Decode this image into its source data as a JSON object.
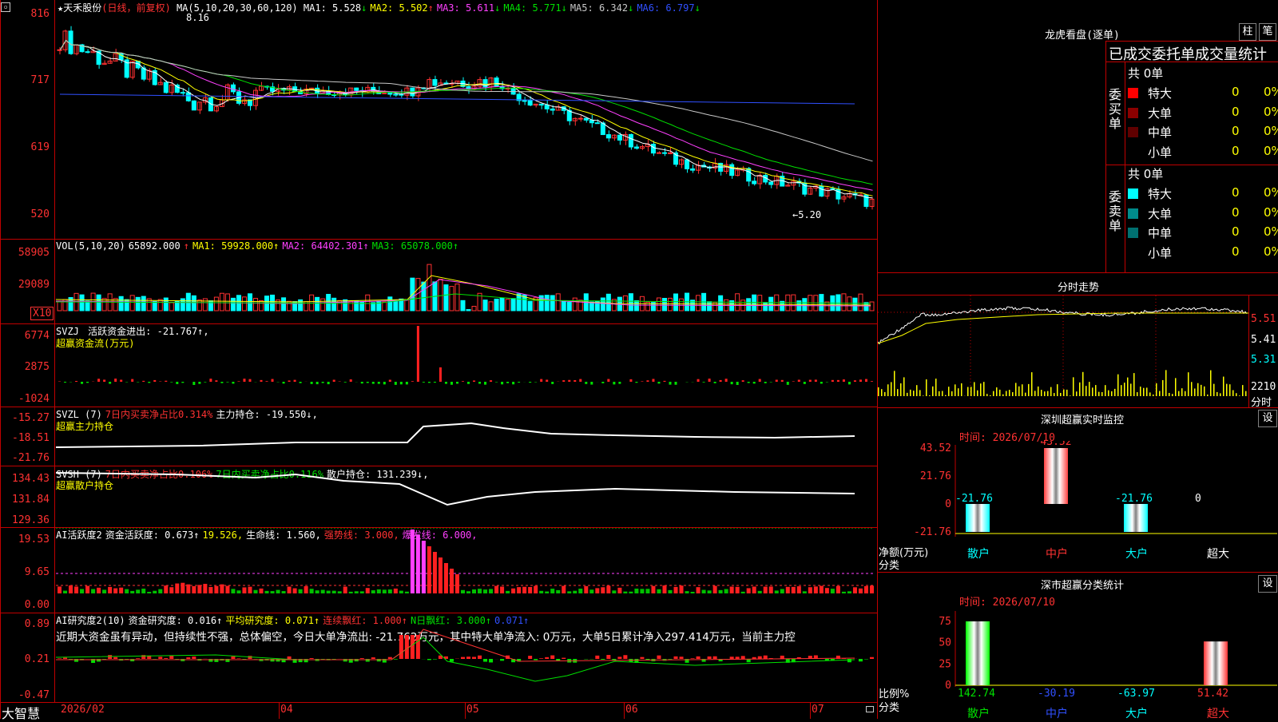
{
  "header": {
    "star": "★",
    "stock_name": "天禾股份",
    "period_info": "(日线，前复权)",
    "ma_label": "MA(5,10,20,30,60,120)",
    "ma": [
      {
        "label": "MA1:",
        "value": "5.528",
        "dir": "↓",
        "color": "#ffffff"
      },
      {
        "label": "MA2:",
        "value": "5.502",
        "dir": "↑",
        "color": "#ffff00"
      },
      {
        "label": "MA3:",
        "value": "5.611",
        "dir": "↓",
        "color": "#ff40ff"
      },
      {
        "label": "MA4:",
        "value": "5.771",
        "dir": "↓",
        "color": "#00e000"
      },
      {
        "label": "MA5:",
        "value": "6.342",
        "dir": "↓",
        "color": "#c8c8c8"
      },
      {
        "label": "MA6:",
        "value": "6.797",
        "dir": "↓",
        "color": "#3050ff"
      }
    ],
    "corner_icon": "restore-icon"
  },
  "main_chart": {
    "y_labels": [
      "816",
      "717",
      "619",
      "520"
    ],
    "high_label": "8.16",
    "low_label": "←5.20"
  },
  "volume_panel": {
    "title": "VOL(5,10,20)",
    "vol": "65892.000",
    "vol_dir": "↑",
    "ma1": "MA1: 59928.000↑",
    "ma2": "MA2: 64402.301↑",
    "ma3": "MA3: 65078.000↑",
    "y_labels": [
      "58905",
      "29089"
    ],
    "unit": "X10"
  },
  "svzj_panel": {
    "title": "SVZJ",
    "text": "活跃资金进出: -21.767↑,",
    "subtitle": "超赢资金流(万元)",
    "y_labels": [
      "6774",
      "2875",
      "-1024"
    ]
  },
  "svzl_panel": {
    "title": "SVZL (7)",
    "ratio": "7日内买卖净占比0.314%",
    "holding": "主力持仓: -19.550↓,",
    "subtitle": "超赢主力持仓",
    "y_labels": [
      "-15.27",
      "-18.51",
      "-21.76"
    ]
  },
  "svsh_panel": {
    "title": "SVSH (7)",
    "ratio1": "7日内买卖净占比0.106%",
    "ratio2": "7日内买卖净占比0.116%",
    "holding": "散户持仓: 131.239↓,",
    "subtitle": "超赢散户持仓",
    "y_labels": [
      "134.43",
      "131.84",
      "129.36"
    ]
  },
  "ai_active_panel": {
    "title": "AI活跃度2",
    "a": "资金活跃度: 0.673↑",
    "b": "19.526,",
    "c": "生命线: 1.560,",
    "d": "强势线: 3.000,",
    "e": "爆发线: 6.000,",
    "y_labels": [
      "19.53",
      "9.65",
      "0.00"
    ]
  },
  "ai_research_panel": {
    "title": "AI研究度2(10)",
    "a": "资金研究度: 0.016↑",
    "b": "平均研究度: 0.071↑",
    "c": "连续飘红: 1.000↑",
    "d": "N日飘红: 3.000↑",
    "e": "0.071↑",
    "comment": "近期大资金虽有异动，但持续性不强，总体偏空，今日大单净流出: -21.762万元，其中特大单净流入: 0万元，大单5日累计净入297.414万元，当前主力控",
    "y_labels": [
      "0.89",
      "0.21",
      "-0.47"
    ]
  },
  "x_axis": {
    "brand": "大智慧",
    "dates": [
      "2026/02",
      "04",
      "05",
      "06",
      "07"
    ]
  },
  "dragon_tiger": {
    "title": "龙虎看盘(逐单)",
    "btn1": "柱",
    "btn2": "笔",
    "subtitle": "已成交委托单成交量统计",
    "buy_label": "委买单",
    "sell_label": "委卖单",
    "buy_total": "共 0单",
    "sell_total": "共 0单",
    "buy_rows": [
      {
        "label": "特大",
        "count": "0",
        "pct": "0%",
        "color": "#ff0000"
      },
      {
        "label": "大单",
        "count": "0",
        "pct": "0%",
        "color": "#8b0000"
      },
      {
        "label": "中单",
        "count": "0",
        "pct": "0%",
        "color": "#600000"
      },
      {
        "label": "小单",
        "count": "0",
        "pct": "0%",
        "color": ""
      }
    ],
    "sell_rows": [
      {
        "label": "特大",
        "count": "0",
        "pct": "0%",
        "color": "#00ffff"
      },
      {
        "label": "大单",
        "count": "0",
        "pct": "0%",
        "color": "#008b8b"
      },
      {
        "label": "中单",
        "count": "0",
        "pct": "0%",
        "color": "#007070"
      },
      {
        "label": "小单",
        "count": "0",
        "pct": "0%",
        "color": ""
      }
    ]
  },
  "intraday": {
    "title": "分时走势",
    "y_labels": [
      "5.51",
      "5.41",
      "5.31"
    ],
    "vol_label": "2210",
    "vol_unit": "分时"
  },
  "sz_monitor": {
    "title": "深圳超赢实时监控",
    "btn": "设",
    "time": "时间: 2026/07/10",
    "y_labels": [
      "43.52",
      "21.76",
      "0",
      "-21.76"
    ],
    "top_value": "43.52",
    "values": [
      "-21.76",
      "",
      "-21.76",
      "0"
    ],
    "axis_caption1": "净额(万元)",
    "axis_caption2": "分类",
    "categories": [
      "散户",
      "中户",
      "大户",
      "超大"
    ]
  },
  "sz_stats": {
    "title": "深市超赢分类统计",
    "btn": "设",
    "time": "时间: 2026/07/10",
    "y_labels": [
      "75",
      "50",
      "25",
      "0"
    ],
    "values": [
      "142.74",
      "-30.19",
      "-63.97",
      "51.42"
    ],
    "axis_caption1": "比例%",
    "axis_caption2": "分类",
    "categories": [
      "散户",
      "中户",
      "大户",
      "超大"
    ]
  }
}
